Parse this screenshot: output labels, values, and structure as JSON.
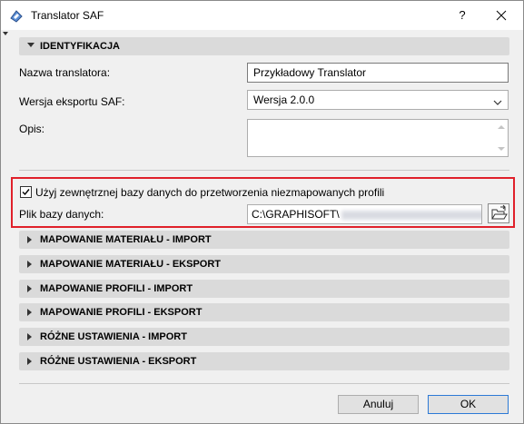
{
  "window": {
    "title": "Translator SAF",
    "help_label": "?"
  },
  "identification": {
    "header": "IDENTYFIKACJA",
    "translator_name_label": "Nazwa translatora:",
    "translator_name_value": "Przykładowy Translator",
    "export_version_label": "Wersja eksportu SAF:",
    "export_version_value": "Wersja 2.0.0",
    "description_label": "Opis:"
  },
  "external_db": {
    "checkbox_label": "Użyj zewnętrznej bazy danych do przetworzenia niezmapowanych profili",
    "checked": true,
    "file_label": "Plik bazy danych:",
    "file_path_visible": "C:\\GRAPHISOFT\\"
  },
  "sections": [
    {
      "label": "MAPOWANIE MATERIAŁU - IMPORT"
    },
    {
      "label": "MAPOWANIE MATERIAŁU - EKSPORT"
    },
    {
      "label": "MAPOWANIE PROFILI - IMPORT"
    },
    {
      "label": "MAPOWANIE PROFILI - EKSPORT"
    },
    {
      "label": "RÓŻNE USTAWIENIA - IMPORT"
    },
    {
      "label": "RÓŻNE USTAWIENIA - EKSPORT"
    }
  ],
  "buttons": {
    "cancel": "Anuluj",
    "ok": "OK"
  },
  "colors": {
    "highlight": "#e0202a",
    "section_bg": "#dadada",
    "ok_border": "#2d7ad6"
  }
}
